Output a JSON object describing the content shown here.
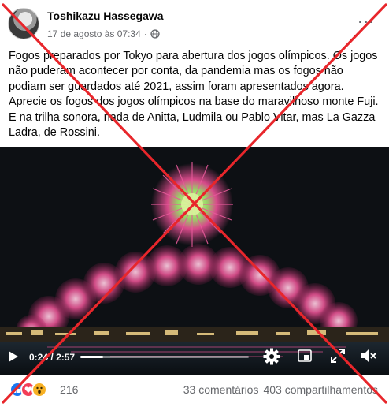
{
  "post": {
    "author": "Toshikazu Hassegawa",
    "date": "17 de agosto às 07:34",
    "separator": "·",
    "privacy_icon": "globe-icon",
    "more_label": "···",
    "text": "Fogos preparados por Tokyo para abertura dos jogos olímpicos. Os jogos não puderam acontecer por conta,  da pandemia mas os fogos não podiam ser guardados até 2021, assim foram apresentados agora. Aprecie os fogos dos jogos olímpicos na base do maravilhoso monte Fuji. E na trilha sonora, nada de Anitta, Ludmila ou Pablo Vitar, mas La Gazza Ladra, de Rossini."
  },
  "video": {
    "time_current": "0:24",
    "time_separator": "/",
    "time_total": "2:57",
    "progress": 0.136,
    "controls": [
      "play-icon",
      "settings-gear-icon",
      "picture-in-picture-icon",
      "fullscreen-icon",
      "volume-muted-icon"
    ]
  },
  "footer": {
    "reactions": [
      "like-icon",
      "love-icon",
      "wow-icon"
    ],
    "reaction_count": "216",
    "comments": "33 comentários",
    "shares": "403 compartilhamentos"
  },
  "overlay": {
    "type": "red-cross-fact-check",
    "color": "#e8262b"
  },
  "colors": {
    "secondary_text": "#65676b",
    "primary_text": "#050505",
    "like": "#1877f2",
    "love": "#f33e58",
    "wow": "#f7b125",
    "firework_pink": "#e0508f",
    "firework_green": "#6fd14a"
  }
}
